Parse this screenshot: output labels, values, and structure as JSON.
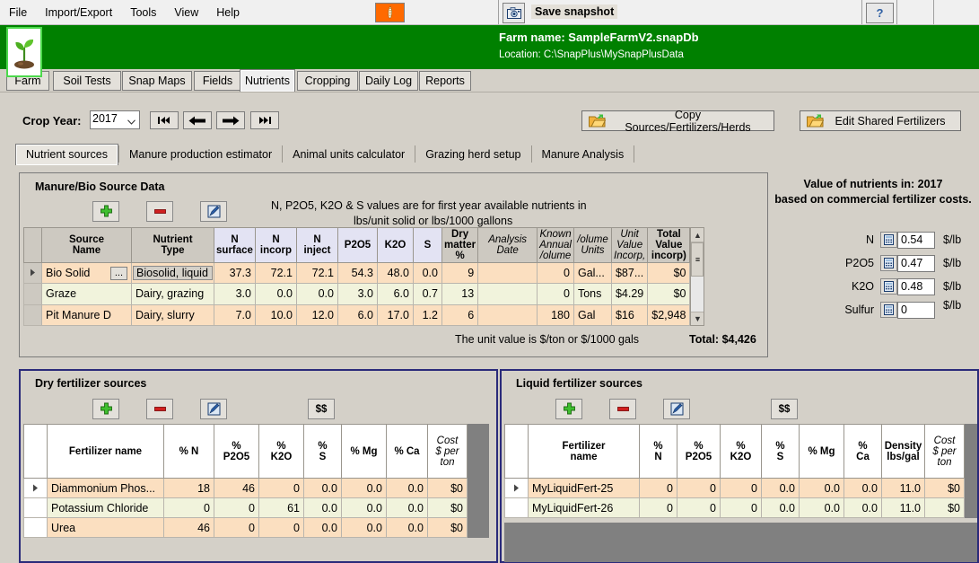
{
  "menu": {
    "items": [
      "File",
      "Import/Export",
      "Tools",
      "View",
      "Help"
    ],
    "corn_icon": "corn-icon",
    "snapshot_icon": "camera-icon",
    "snapshot_label": "Save snapshot",
    "help_label": "?"
  },
  "header": {
    "logo_icon": "seedling-icon",
    "farm_name": "Farm name: SampleFarmV2.snapDb",
    "location": "Location: C:\\SnapPlus\\MySnapPlusData"
  },
  "main_tabs": [
    {
      "label": "Farm",
      "active": false
    },
    {
      "label": "Soil Tests",
      "active": false
    },
    {
      "label": "Snap Maps",
      "active": false
    },
    {
      "label": "Fields",
      "active": false
    },
    {
      "label": "Nutrients",
      "active": true
    },
    {
      "label": "Cropping",
      "active": false
    },
    {
      "label": "Daily Log",
      "active": false
    },
    {
      "label": "Reports",
      "active": false
    }
  ],
  "crop_year": {
    "label": "Crop Year:",
    "value": "2017",
    "nav": [
      "first",
      "previous",
      "next",
      "last"
    ]
  },
  "toolbar": {
    "copy_sources_label": "Copy Sources/Fertilizers/Herds",
    "edit_shared_label": "Edit Shared Fertilizers"
  },
  "sub_tabs": [
    {
      "label": "Nutrient sources",
      "active": true
    },
    {
      "label": "Manure production estimator",
      "active": false
    },
    {
      "label": "Animal units calculator",
      "active": false
    },
    {
      "label": "Grazing herd setup",
      "active": false
    },
    {
      "label": "Manure Analysis",
      "active": false
    }
  ],
  "manure_panel": {
    "title": "Manure/Bio Source Data",
    "note_line1": "N, P2O5, K2O & S values are for first year available nutrients in",
    "note_line2": "lbs/unit solid    or    lbs/1000 gallons",
    "buttons": [
      "add",
      "remove",
      "edit"
    ],
    "columns": [
      "Source\nName",
      "Nutrient\nType",
      "N\nsurface",
      "N\nincorp",
      "N\ninject",
      "P2O5",
      "K2O",
      "S",
      "Dry\nmatter\n%",
      "Analysis\nDate",
      "Known\nAnnual\nVolume",
      "Volume\nUnits",
      "Unit\nValue\nIncorp)",
      "Total\nValue\nincorp)"
    ],
    "rows": [
      {
        "selected": true,
        "source_name": "Bio Solid",
        "has_ellipsis_button": true,
        "nutrient_type": "Biosolid, liquid",
        "n_surface": "37.3",
        "n_incorp": "72.1",
        "n_inject": "72.1",
        "p2o5": "54.3",
        "k2o": "48.0",
        "s": "0.0",
        "dry_matter": "9",
        "analysis_date": "",
        "known_annual_volume": "0",
        "volume_units": "Gal...",
        "unit_value": "$87...",
        "total_value": "$0"
      },
      {
        "selected": false,
        "source_name": "Graze",
        "has_ellipsis_button": false,
        "nutrient_type": "Dairy, grazing",
        "n_surface": "3.0",
        "n_incorp": "0.0",
        "n_inject": "0.0",
        "p2o5": "3.0",
        "k2o": "6.0",
        "s": "0.7",
        "dry_matter": "13",
        "analysis_date": "",
        "known_annual_volume": "0",
        "volume_units": "Tons",
        "unit_value": "$4.29",
        "total_value": "$0"
      },
      {
        "selected": false,
        "source_name": "Pit Manure D",
        "has_ellipsis_button": false,
        "nutrient_type": "Dairy, slurry",
        "n_surface": "7.0",
        "n_incorp": "10.0",
        "n_inject": "12.0",
        "p2o5": "6.0",
        "k2o": "17.0",
        "s": "1.2",
        "dry_matter": "6",
        "analysis_date": "",
        "known_annual_volume": "180",
        "volume_units": "Gal",
        "unit_value": "$16",
        "total_value": "$2,948"
      }
    ],
    "footer_note": "The unit value is $/ton or $/1000 gals",
    "total_label": "Total: $4,426"
  },
  "value_panel": {
    "title_line1": "Value of nutrients in: 2017",
    "title_line2": "based on commercial fertilizer costs.",
    "rows": [
      {
        "label": "N",
        "value": "0.54",
        "unit": "$/lb"
      },
      {
        "label": "P2O5",
        "value": "0.47",
        "unit": "$/lb"
      },
      {
        "label": "K2O",
        "value": "0.48",
        "unit": "$/lb"
      },
      {
        "label": "Sulfur",
        "value": "0",
        "unit": "$/lb"
      }
    ]
  },
  "dry_fertilizer": {
    "title": "Dry fertilizer sources",
    "buttons": [
      "add",
      "remove",
      "edit",
      "cost"
    ],
    "columns": [
      "Fertilizer name",
      "% N",
      "%\nP2O5",
      "%\nK2O",
      "%\nS",
      "% Mg",
      "% Ca",
      "Cost\n$ per\nton"
    ],
    "rows": [
      {
        "selected": true,
        "name": "Diammonium Phos...",
        "n": "18",
        "p2o5": "46",
        "k2o": "0",
        "s": "0.0",
        "mg": "0.0",
        "ca": "0.0",
        "cost": "$0"
      },
      {
        "selected": false,
        "name": "Potassium Chloride",
        "n": "0",
        "p2o5": "0",
        "k2o": "61",
        "s": "0.0",
        "mg": "0.0",
        "ca": "0.0",
        "cost": "$0"
      },
      {
        "selected": false,
        "name": "Urea",
        "n": "46",
        "p2o5": "0",
        "k2o": "0",
        "s": "0.0",
        "mg": "0.0",
        "ca": "0.0",
        "cost": "$0"
      }
    ]
  },
  "liquid_fertilizer": {
    "title": "Liquid fertilizer sources",
    "buttons": [
      "add",
      "remove",
      "edit",
      "cost"
    ],
    "columns": [
      "Fertilizer\nname",
      "%\nN",
      "%\nP2O5",
      "%\nK2O",
      "%\nS",
      "% Mg",
      "%\nCa",
      "Density\nlbs/gal",
      "Cost\n$ per\nton"
    ],
    "rows": [
      {
        "selected": true,
        "name": "MyLiquidFert-25",
        "n": "0",
        "p2o5": "0",
        "k2o": "0",
        "s": "0.0",
        "mg": "0.0",
        "ca": "0.0",
        "density": "11.0",
        "cost": "$0"
      },
      {
        "selected": false,
        "name": "MyLiquidFert-26",
        "n": "0",
        "p2o5": "0",
        "k2o": "0",
        "s": "0.0",
        "mg": "0.0",
        "ca": "0.0",
        "density": "11.0",
        "cost": "$0"
      }
    ]
  },
  "colors": {
    "green_header": "#008000",
    "panel_bg": "#d4d0c8",
    "row_odd": "#fbdfc0",
    "row_even": "#f1f3dc",
    "header_lavender": "#e3e3f3",
    "fert_border": "#2a2a7a"
  }
}
